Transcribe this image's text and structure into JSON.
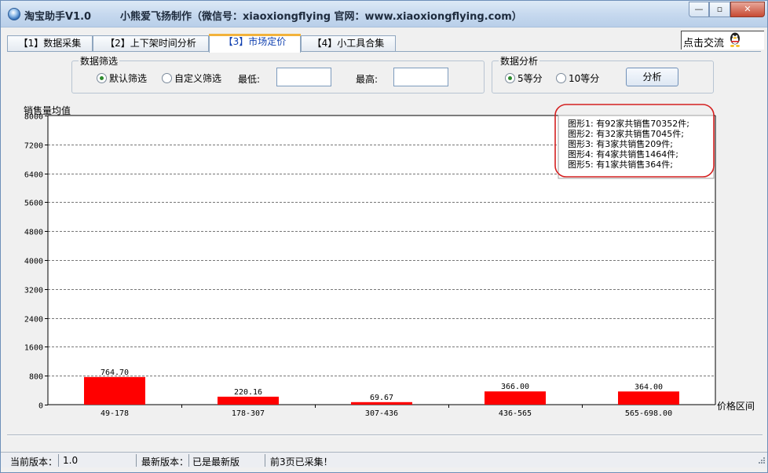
{
  "window": {
    "title": "淘宝助手V1.0",
    "subtitle": "小熊爱飞扬制作（微信号：xiaoxiongflying   官网：www.xiaoxiongflying.com）",
    "min_glyph": "—",
    "max_glyph": "▫",
    "close_glyph": "✕"
  },
  "tabs": [
    {
      "label": "【1】数据采集",
      "active": false
    },
    {
      "label": "【2】上下架时间分析",
      "active": false
    },
    {
      "label": "【3】市场定价",
      "active": true
    },
    {
      "label": "【4】小工具合集",
      "active": false
    }
  ],
  "contact": {
    "label": "点击交流",
    "icon": "qq-penguin-icon"
  },
  "filter": {
    "legend": "数据筛选",
    "option_default": "默认筛选",
    "option_custom": "自定义筛选",
    "selected": "默认筛选",
    "min_label": "最低:",
    "min_value": "",
    "max_label": "最高:",
    "max_value": ""
  },
  "analysis": {
    "legend": "数据分析",
    "option_5": "5等分",
    "option_10": "10等分",
    "selected": "5等分",
    "button": "分析"
  },
  "chart_data": {
    "type": "bar",
    "ylabel": "销售量均值",
    "xlabel": "价格区间",
    "ylim": [
      0,
      8000
    ],
    "y_ticks": [
      0,
      800,
      1600,
      2400,
      3200,
      4000,
      4800,
      5600,
      6400,
      7200,
      8000
    ],
    "grid": "horizontal-dashed",
    "categories": [
      "49-178",
      "178-307",
      "307-436",
      "436-565",
      "565-698.00"
    ],
    "values": [
      764.7,
      220.16,
      69.67,
      366.0,
      364.0
    ],
    "value_labels": [
      "764.70",
      "220.16",
      "69.67",
      "366.00",
      "364.00"
    ],
    "bar_color": "#ff0000",
    "legend_position": "top-right",
    "legend_entries": [
      "图形1: 有92家共销售70352件;",
      "图形2: 有32家共销售7045件;",
      "图形3: 有3家共销售209件;",
      "图形4: 有4家共销售1464件;",
      "图形5: 有1家共销售364件;"
    ],
    "highlight_color": "#d42020"
  },
  "status": {
    "current_label": "当前版本：",
    "current_value": "1.0",
    "latest_label": "最新版本：",
    "latest_value": "已是最新版",
    "message": "前3页已采集！"
  }
}
